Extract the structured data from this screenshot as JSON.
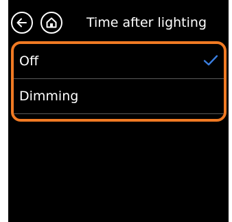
{
  "header": {
    "title": "Time after lighting",
    "back_icon": "arrow-left-icon",
    "home_icon": "home-icon"
  },
  "options": [
    {
      "label": "Off",
      "selected": true
    },
    {
      "label": "Dimming",
      "selected": false
    }
  ],
  "colors": {
    "background": "#000000",
    "highlight_frame": "#f07a23",
    "check": "#3a7ee0",
    "text": "#ffffff"
  },
  "icons": {
    "check": "checkmark-icon"
  }
}
